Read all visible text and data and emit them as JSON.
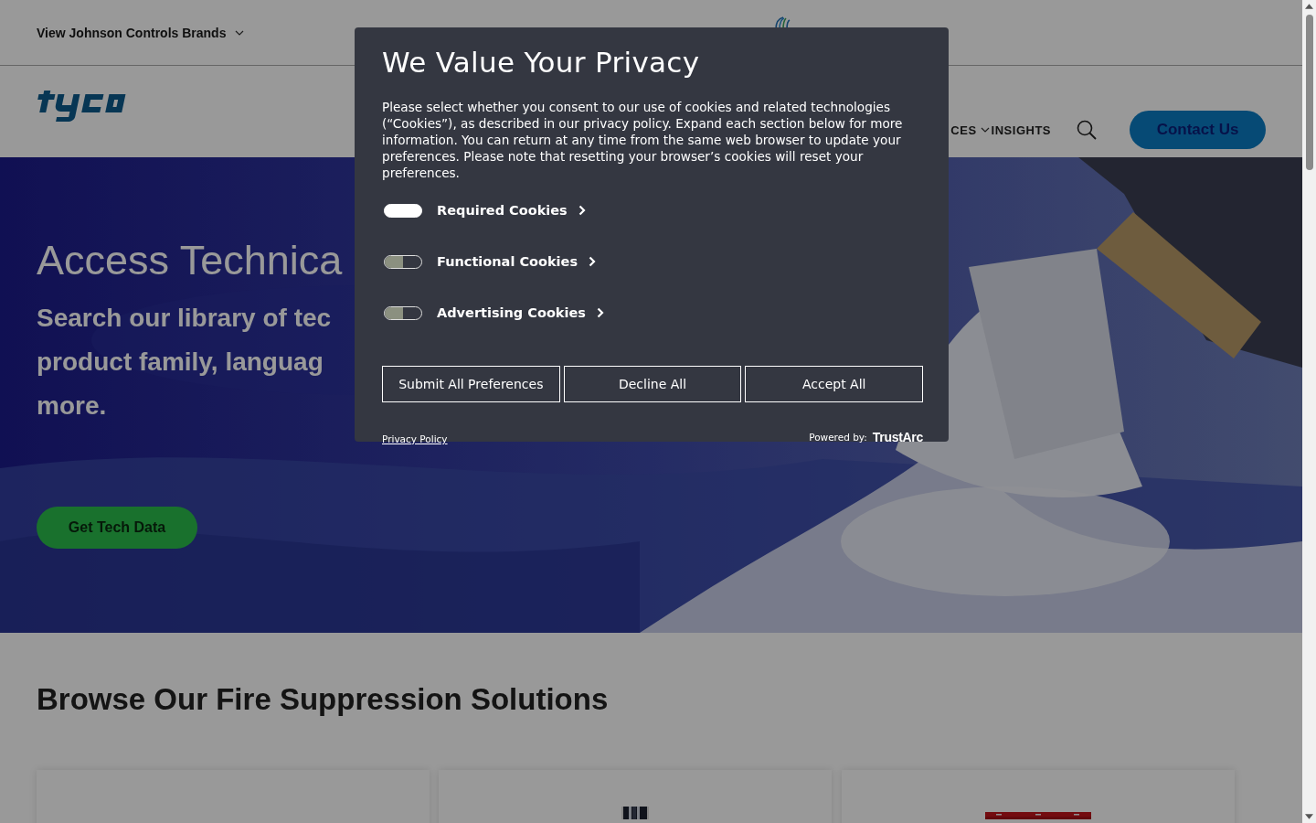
{
  "top_bar": {
    "brands_link": "View Johnson Controls Brands"
  },
  "nav": {
    "items": [
      {
        "label": "CES",
        "has_menu": true
      },
      {
        "label": "INSIGHTS",
        "has_menu": false
      }
    ],
    "contact_button": "Contact Us"
  },
  "hero": {
    "title": "Access Technica",
    "subtitle_lines": [
      "Search our library of tec",
      "product family, languag",
      "more."
    ],
    "button": "Get Tech Data"
  },
  "section": {
    "title": "Browse Our Fire Suppression Solutions"
  },
  "cards": [
    {
      "kind": "blank"
    },
    {
      "kind": "picture"
    },
    {
      "kind": "picture"
    }
  ],
  "privacy_dialog": {
    "title": "We Value Your Privacy",
    "text": "Please select whether you consent to our use of cookies and related technologies (“Cookies”), as described in our privacy policy. Expand each section below for more information. You can return at any time from the same web browser to update your preferences. Please note that resetting your browser’s cookies will reset your preferences.",
    "categories": [
      {
        "label": "Required Cookies",
        "on": true
      },
      {
        "label": "Functional Cookies",
        "on": false
      },
      {
        "label": "Advertising Cookies",
        "on": false
      }
    ],
    "buttons": [
      "Submit All Preferences",
      "Decline All",
      "Accept All"
    ],
    "privacy_link": "Privacy Policy",
    "powered_by": "Powered by:",
    "vendor": "TrustArc"
  }
}
